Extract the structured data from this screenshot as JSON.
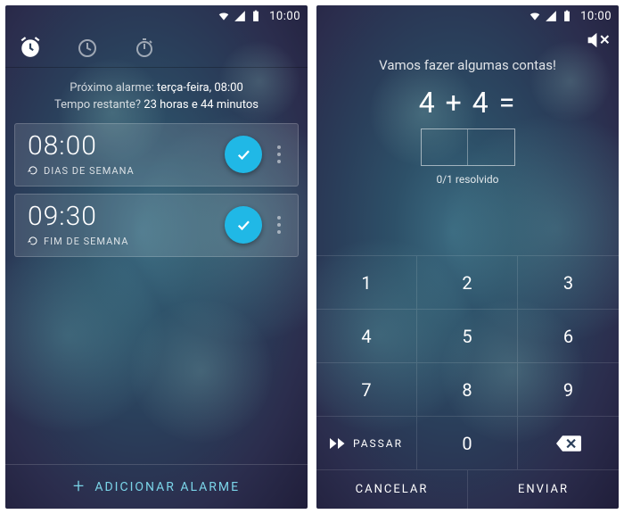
{
  "status": {
    "time": "10:00"
  },
  "left": {
    "next_alarm_label": "Próximo alarme:",
    "next_alarm_value": "terça-feira, 08:00",
    "remaining_label": "Tempo restante?",
    "remaining_value": "23 horas e 44 minutos",
    "alarms": [
      {
        "time": "08:00",
        "repeat": "DIAS DE SEMANA"
      },
      {
        "time": "09:30",
        "repeat": "FIM DE SEMANA"
      }
    ],
    "add_label": "ADICIONAR ALARME"
  },
  "right": {
    "header": "Vamos fazer algumas contas!",
    "equation": "4 + 4 =",
    "progress": "0/1 resolvido",
    "keys": [
      "1",
      "2",
      "3",
      "4",
      "5",
      "6",
      "7",
      "8",
      "9"
    ],
    "pass_label": "PASSAR",
    "zero": "0",
    "cancel": "CANCELAR",
    "send": "ENVIAR"
  }
}
